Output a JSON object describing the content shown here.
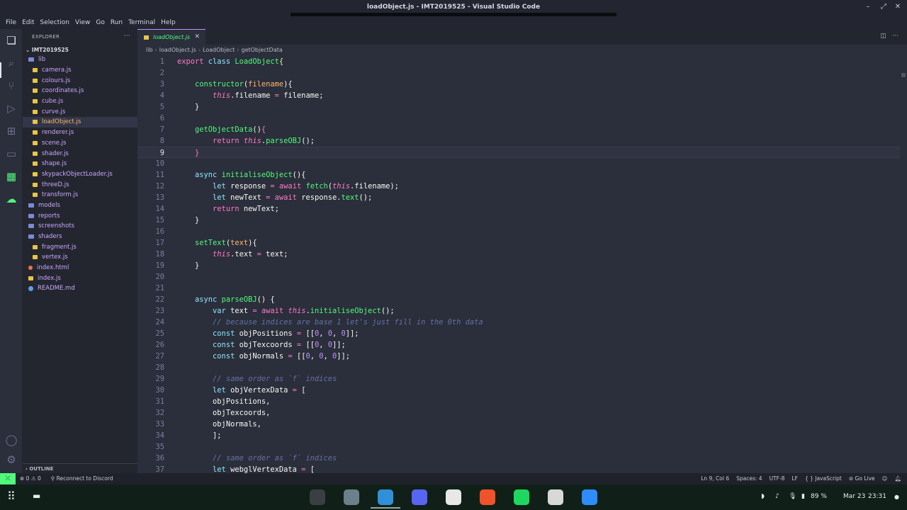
{
  "window": {
    "title": "loadObject.js - IMT2019525 - Visual Studio Code"
  },
  "menu": [
    "File",
    "Edit",
    "Selection",
    "View",
    "Go",
    "Run",
    "Terminal",
    "Help"
  ],
  "explorer": {
    "header": "EXPLORER",
    "root": "IMT2019525",
    "items": [
      {
        "label": "lib",
        "kind": "folder",
        "indent": 1
      },
      {
        "label": "camera.js",
        "kind": "file",
        "indent": 2
      },
      {
        "label": "colours.js",
        "kind": "file",
        "indent": 2
      },
      {
        "label": "coordinates.js",
        "kind": "file",
        "indent": 2
      },
      {
        "label": "cube.js",
        "kind": "file",
        "indent": 2
      },
      {
        "label": "curve.js",
        "kind": "file",
        "indent": 2
      },
      {
        "label": "loadObject.js",
        "kind": "file",
        "indent": 2,
        "active": true
      },
      {
        "label": "renderer.js",
        "kind": "file",
        "indent": 2
      },
      {
        "label": "scene.js",
        "kind": "file",
        "indent": 2
      },
      {
        "label": "shader.js",
        "kind": "file",
        "indent": 2
      },
      {
        "label": "shape.js",
        "kind": "file",
        "indent": 2
      },
      {
        "label": "skypackObjectLoader.js",
        "kind": "file",
        "indent": 2
      },
      {
        "label": "threeD.js",
        "kind": "file",
        "indent": 2
      },
      {
        "label": "transform.js",
        "kind": "file",
        "indent": 2
      },
      {
        "label": "models",
        "kind": "folder-closed",
        "indent": 1
      },
      {
        "label": "reports",
        "kind": "folder-closed",
        "indent": 1
      },
      {
        "label": "screenshots",
        "kind": "folder-closed",
        "indent": 1
      },
      {
        "label": "shaders",
        "kind": "folder",
        "indent": 1
      },
      {
        "label": "fragment.js",
        "kind": "file",
        "indent": 2
      },
      {
        "label": "vertex.js",
        "kind": "file",
        "indent": 2
      },
      {
        "label": "index.html",
        "kind": "html",
        "indent": 1
      },
      {
        "label": "index.js",
        "kind": "file",
        "indent": 1
      },
      {
        "label": "README.md",
        "kind": "info",
        "indent": 1
      }
    ],
    "outline": "OUTLINE"
  },
  "tab": {
    "label": "loadObject.js"
  },
  "breadcrumb": [
    "lib",
    "loadObject.js",
    "LoadObject",
    "getObjectData"
  ],
  "editor": {
    "current_line": 9,
    "lines": [
      [
        [
          "k",
          "export "
        ],
        [
          "c",
          "class "
        ],
        [
          "f",
          "LoadObject"
        ],
        [
          "br",
          "{"
        ]
      ],
      [],
      [
        [
          "w",
          "    "
        ],
        [
          "f",
          "constructor"
        ],
        [
          "w",
          "("
        ],
        [
          "p",
          "filename"
        ],
        [
          "w",
          "){"
        ]
      ],
      [
        [
          "w",
          "        "
        ],
        [
          "t",
          "this"
        ],
        [
          "w",
          ".filename "
        ],
        [
          "o",
          "="
        ],
        [
          "w",
          " filename;"
        ]
      ],
      [
        [
          "w",
          "    }"
        ]
      ],
      [],
      [
        [
          "w",
          "    "
        ],
        [
          "f",
          "getObjectData"
        ],
        [
          "w",
          "()"
        ],
        [
          "k",
          "{"
        ]
      ],
      [
        [
          "w",
          "        "
        ],
        [
          "k",
          "return "
        ],
        [
          "t",
          "this"
        ],
        [
          "w",
          "."
        ],
        [
          "f",
          "parseOBJ"
        ],
        [
          "w",
          "();"
        ]
      ],
      [
        [
          "w",
          "    "
        ],
        [
          "k",
          "}"
        ]
      ],
      [],
      [
        [
          "w",
          "    "
        ],
        [
          "c",
          "async "
        ],
        [
          "f",
          "initialiseObject"
        ],
        [
          "w",
          "(){"
        ]
      ],
      [
        [
          "w",
          "        "
        ],
        [
          "c",
          "let "
        ],
        [
          "w",
          "response "
        ],
        [
          "o",
          "="
        ],
        [
          "w",
          " "
        ],
        [
          "k",
          "await "
        ],
        [
          "f",
          "fetch"
        ],
        [
          "w",
          "("
        ],
        [
          "t",
          "this"
        ],
        [
          "w",
          ".filename);"
        ]
      ],
      [
        [
          "w",
          "        "
        ],
        [
          "c",
          "let "
        ],
        [
          "w",
          "newText "
        ],
        [
          "o",
          "="
        ],
        [
          "w",
          " "
        ],
        [
          "k",
          "await "
        ],
        [
          "w",
          "response."
        ],
        [
          "f",
          "text"
        ],
        [
          "w",
          "();"
        ]
      ],
      [
        [
          "w",
          "        "
        ],
        [
          "k",
          "return "
        ],
        [
          "w",
          "newText;"
        ]
      ],
      [
        [
          "w",
          "    }"
        ]
      ],
      [],
      [
        [
          "w",
          "    "
        ],
        [
          "f",
          "setText"
        ],
        [
          "w",
          "("
        ],
        [
          "p",
          "text"
        ],
        [
          "w",
          "){"
        ]
      ],
      [
        [
          "w",
          "        "
        ],
        [
          "t",
          "this"
        ],
        [
          "w",
          ".text "
        ],
        [
          "o",
          "="
        ],
        [
          "w",
          " text;"
        ]
      ],
      [
        [
          "w",
          "    }"
        ]
      ],
      [],
      [],
      [
        [
          "w",
          "    "
        ],
        [
          "c",
          "async "
        ],
        [
          "f",
          "parseOBJ"
        ],
        [
          "w",
          "() {"
        ]
      ],
      [
        [
          "w",
          "        "
        ],
        [
          "c",
          "var "
        ],
        [
          "w",
          "text "
        ],
        [
          "o",
          "="
        ],
        [
          "w",
          " "
        ],
        [
          "k",
          "await "
        ],
        [
          "t",
          "this"
        ],
        [
          "w",
          "."
        ],
        [
          "f",
          "initialiseObject"
        ],
        [
          "w",
          "();"
        ]
      ],
      [
        [
          "w",
          "        "
        ],
        [
          "cm",
          "// because indices are base 1 let's just fill in the 0th data"
        ]
      ],
      [
        [
          "w",
          "        "
        ],
        [
          "c",
          "const "
        ],
        [
          "w",
          "objPositions "
        ],
        [
          "o",
          "="
        ],
        [
          "w",
          " [["
        ],
        [
          "n",
          "0"
        ],
        [
          "w",
          ", "
        ],
        [
          "n",
          "0"
        ],
        [
          "w",
          ", "
        ],
        [
          "n",
          "0"
        ],
        [
          "w",
          "]];"
        ]
      ],
      [
        [
          "w",
          "        "
        ],
        [
          "c",
          "const "
        ],
        [
          "w",
          "objTexcoords "
        ],
        [
          "o",
          "="
        ],
        [
          "w",
          " [["
        ],
        [
          "n",
          "0"
        ],
        [
          "w",
          ", "
        ],
        [
          "n",
          "0"
        ],
        [
          "w",
          "]];"
        ]
      ],
      [
        [
          "w",
          "        "
        ],
        [
          "c",
          "const "
        ],
        [
          "w",
          "objNormals "
        ],
        [
          "o",
          "="
        ],
        [
          "w",
          " [["
        ],
        [
          "n",
          "0"
        ],
        [
          "w",
          ", "
        ],
        [
          "n",
          "0"
        ],
        [
          "w",
          ", "
        ],
        [
          "n",
          "0"
        ],
        [
          "w",
          "]];"
        ]
      ],
      [],
      [
        [
          "w",
          "        "
        ],
        [
          "cm",
          "// same order as `f` indices"
        ]
      ],
      [
        [
          "w",
          "        "
        ],
        [
          "c",
          "let "
        ],
        [
          "w",
          "objVertexData "
        ],
        [
          "o",
          "="
        ],
        [
          "w",
          " ["
        ]
      ],
      [
        [
          "w",
          "        objPositions,"
        ]
      ],
      [
        [
          "w",
          "        objTexcoords,"
        ]
      ],
      [
        [
          "w",
          "        objNormals,"
        ]
      ],
      [
        [
          "w",
          "        ];"
        ]
      ],
      [],
      [
        [
          "w",
          "        "
        ],
        [
          "cm",
          "// same order as `f` indices"
        ]
      ],
      [
        [
          "w",
          "        "
        ],
        [
          "c",
          "let "
        ],
        [
          "w",
          "webglVertexData "
        ],
        [
          "o",
          "="
        ],
        [
          "w",
          " ["
        ]
      ]
    ]
  },
  "status": {
    "errors": "⊗ 0",
    "warnings": "⚠ 0",
    "discord": "Reconnect to Discord",
    "position": "Ln 9, Col 6",
    "spaces": "Spaces: 4",
    "encoding": "UTF-8",
    "eol": "LF",
    "language": "{ } JavaScript",
    "golive": "Go Live"
  },
  "taskbar": {
    "battery": "89 %",
    "date": "Mar 23",
    "time": "23:31",
    "apps": [
      {
        "name": "terminal",
        "color": "#3a3f44"
      },
      {
        "name": "files",
        "color": "#6d7f8a"
      },
      {
        "name": "vscode",
        "color": "#2f8fd8"
      },
      {
        "name": "discord",
        "color": "#5865f2"
      },
      {
        "name": "slack",
        "color": "#e8e8e8"
      },
      {
        "name": "brave",
        "color": "#f0522a"
      },
      {
        "name": "spotify",
        "color": "#1ed760"
      },
      {
        "name": "document-viewer",
        "color": "#d8d8d8"
      },
      {
        "name": "zoom",
        "color": "#2d8cff"
      }
    ]
  }
}
